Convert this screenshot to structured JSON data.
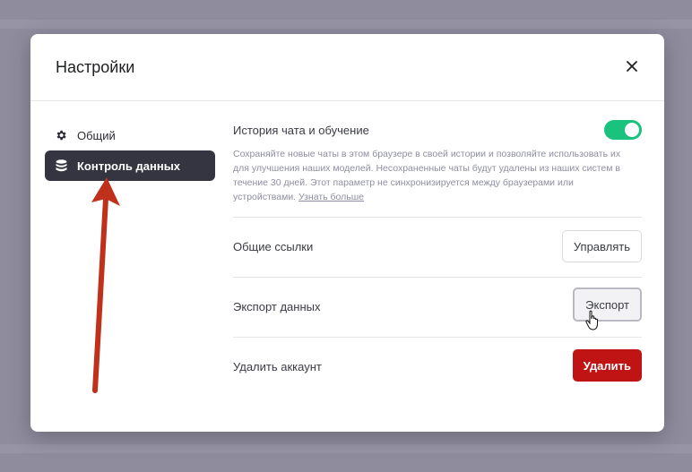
{
  "dialog": {
    "title": "Настройки",
    "close_icon": "close-icon"
  },
  "sidebar": {
    "items": [
      {
        "label": "Общий",
        "icon": "gear-icon",
        "active": false
      },
      {
        "label": "Контроль данных",
        "icon": "database-icon",
        "active": true
      }
    ]
  },
  "settings": {
    "chat_history": {
      "label": "История чата и обучение",
      "description": "Сохраняйте новые чаты в этом браузере в своей истории и позволяйте использовать их для улучшения наших моделей. Несохраненные чаты будут удалены из наших систем в течение 30 дней. Этот параметр не синхронизируется между браузерами или устройствами.",
      "learn_more": "Узнать больше",
      "enabled": true
    },
    "shared_links": {
      "label": "Общие ссылки",
      "button": "Управлять"
    },
    "export": {
      "label": "Экспорт данных",
      "button": "Экспорт"
    },
    "delete_account": {
      "label": "Удалить аккаунт",
      "button": "Удалить"
    }
  },
  "colors": {
    "toggle_on": "#19c37d",
    "danger": "#c01414",
    "active_sidebar": "#343541",
    "annotation_arrow": "#c0311c"
  }
}
